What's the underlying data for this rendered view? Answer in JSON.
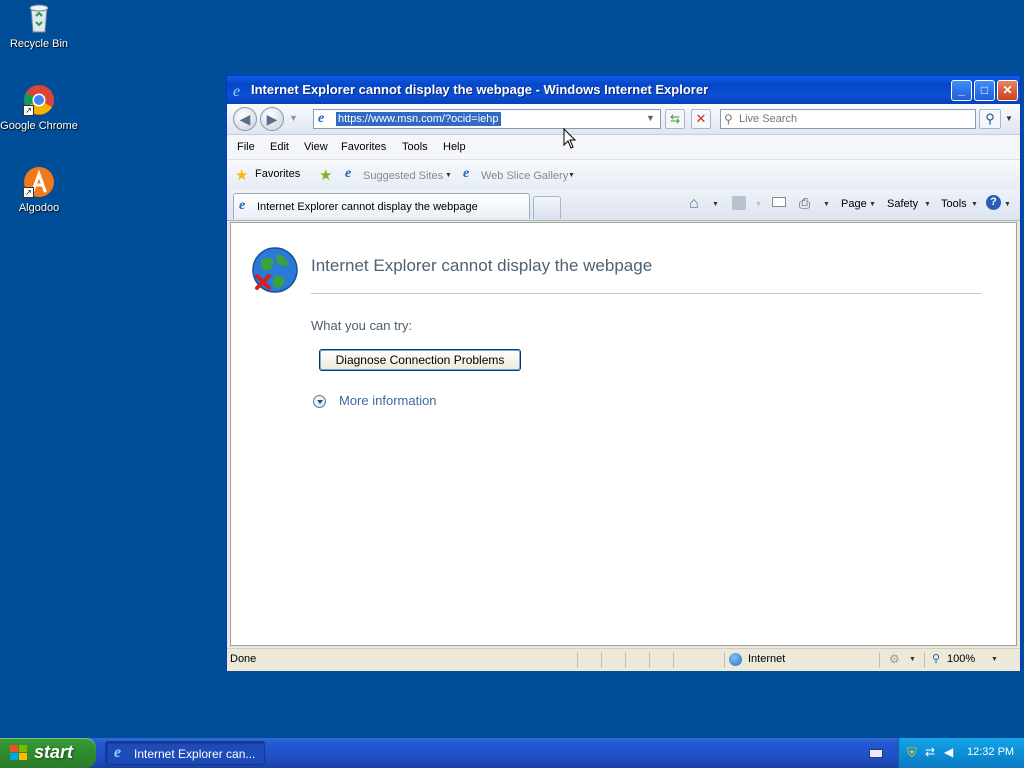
{
  "desktop": {
    "icons": [
      {
        "label": "Recycle Bin",
        "icon": "recycle-bin-icon"
      },
      {
        "label": "Google Chrome",
        "icon": "chrome-icon"
      },
      {
        "label": "Algodoo",
        "icon": "algodoo-icon"
      }
    ]
  },
  "window": {
    "title": "Internet Explorer cannot display the webpage - Windows Internet Explorer",
    "controls": {
      "minimize": "_",
      "maximize": "□",
      "close": "✕"
    }
  },
  "address": {
    "url": "https://www.msn.com/?ocid=iehp",
    "search_placeholder": "Live Search"
  },
  "menu": [
    "File",
    "Edit",
    "View",
    "Favorites",
    "Tools",
    "Help"
  ],
  "favorites_bar": {
    "favorites": "Favorites",
    "suggested_sites": "Suggested Sites",
    "web_slice_gallery": "Web Slice Gallery"
  },
  "tab": {
    "title": "Internet Explorer cannot display the webpage"
  },
  "command_bar": {
    "page": "Page",
    "safety": "Safety",
    "tools": "Tools"
  },
  "content": {
    "heading": "Internet Explorer cannot display the webpage",
    "what_you_can_try": "What you can try:",
    "diagnose_button": "Diagnose Connection Problems",
    "more_information": "More information"
  },
  "status_bar": {
    "status": "Done",
    "zone": "Internet",
    "zoom": "100%"
  },
  "taskbar": {
    "start": "start",
    "task_item": "Internet Explorer can...",
    "clock": "12:32 PM"
  },
  "colors": {
    "desktop": "#004e98",
    "titlebar": "#0a4fd6",
    "start": "#2f8f2f",
    "tray": "#0c8fd7"
  }
}
